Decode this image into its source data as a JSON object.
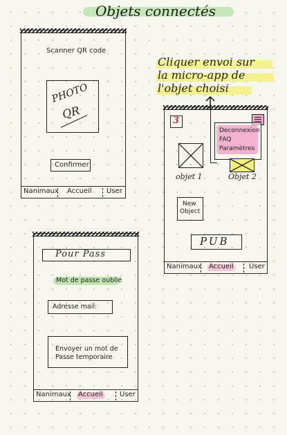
{
  "title": "Objets connectés",
  "annotation": [
    "Cliquer envoi sur",
    "la micro-app de",
    "l'objet choisi"
  ],
  "screens": {
    "qr": {
      "heading": "Scanner QR code",
      "photo_text": "PHOTO",
      "qr_text": "QR",
      "confirm_label": "Confirmer"
    },
    "dashboard": {
      "badge": "3",
      "menu_items": [
        "Deconnexion",
        "FAQ",
        "Paramètres"
      ],
      "object1_label": "objet 1",
      "object2_label": "Objet 2",
      "new_object_label": [
        "New",
        "Object"
      ],
      "pub_label": "PUB"
    },
    "password": {
      "header": "Pour Pass",
      "forgot_label": "Mot de passe oublié",
      "email_placeholder": "Adresse mail:",
      "send_label": [
        "Envoyer un mot de",
        "Passe temporaire"
      ]
    }
  },
  "footer": {
    "left": "Nanimaux",
    "center": "Accueil",
    "right": "User"
  },
  "colors": {
    "title_highlight": "#b6e2a6",
    "annotation_highlight": "#f3f07e",
    "accent_pink": "#f2a6c9"
  }
}
